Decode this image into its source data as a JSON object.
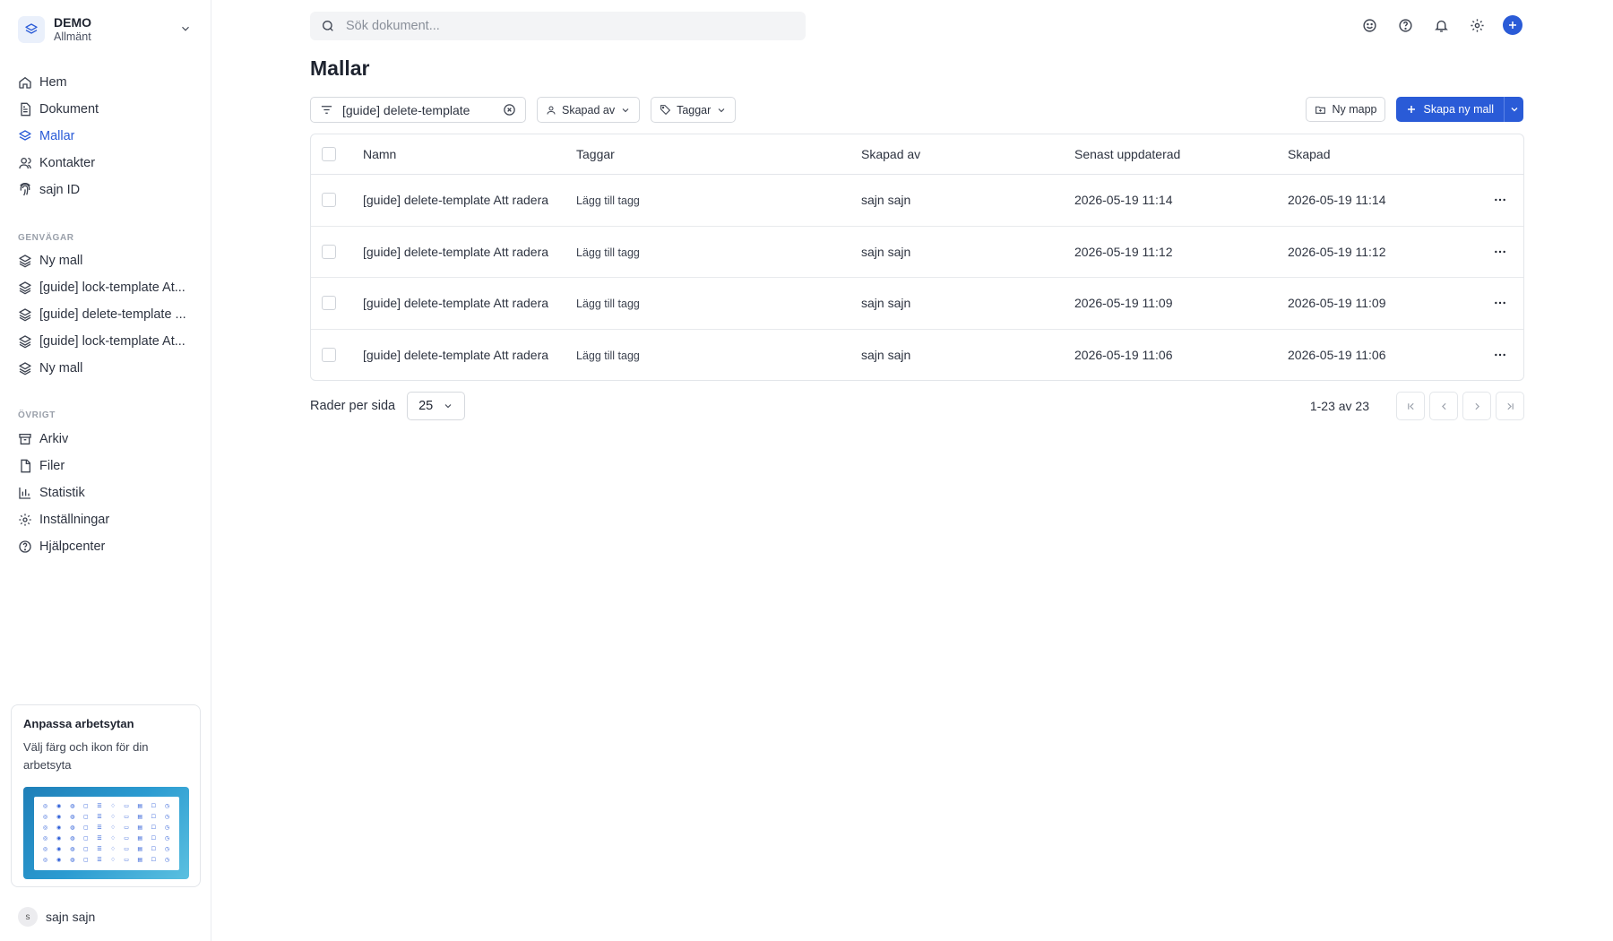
{
  "workspace": {
    "name": "DEMO",
    "subtitle": "Allmänt"
  },
  "nav": [
    {
      "label": "Hem",
      "icon": "home-icon",
      "active": false
    },
    {
      "label": "Dokument",
      "icon": "document-icon",
      "active": false
    },
    {
      "label": "Mallar",
      "icon": "layers-icon",
      "active": true
    },
    {
      "label": "Kontakter",
      "icon": "users-icon",
      "active": false
    },
    {
      "label": "sajn ID",
      "icon": "fingerprint-icon",
      "active": false
    }
  ],
  "shortcuts": {
    "heading": "GENVÄGAR",
    "items": [
      {
        "label": "Ny mall"
      },
      {
        "label": "[guide] lock-template At..."
      },
      {
        "label": "[guide] delete-template ..."
      },
      {
        "label": "[guide] lock-template At..."
      },
      {
        "label": "Ny mall"
      }
    ]
  },
  "other": {
    "heading": "ÖVRIGT",
    "items": [
      {
        "label": "Arkiv",
        "icon": "archive-icon"
      },
      {
        "label": "Filer",
        "icon": "file-icon"
      },
      {
        "label": "Statistik",
        "icon": "bar-chart-icon"
      },
      {
        "label": "Inställningar",
        "icon": "gear-icon"
      },
      {
        "label": "Hjälpcenter",
        "icon": "help-circle-icon"
      }
    ]
  },
  "promo": {
    "title": "Anpassa arbetsytan",
    "description": "Välj färg och ikon för din arbetsyta"
  },
  "user": {
    "initial": "s",
    "name": "sajn sajn"
  },
  "search": {
    "placeholder": "Sök dokument..."
  },
  "page": {
    "title": "Mallar"
  },
  "filters": {
    "query": "[guide] delete-template",
    "created_by_label": "Skapad av",
    "tags_label": "Taggar"
  },
  "actions": {
    "new_folder": "Ny mapp",
    "create_template": "Skapa ny mall"
  },
  "table": {
    "headers": {
      "name": "Namn",
      "tags": "Taggar",
      "created_by": "Skapad av",
      "updated": "Senast uppdaterad",
      "created": "Skapad"
    },
    "rows": [
      {
        "name": "[guide] delete-template Att radera",
        "tags": "Lägg till tagg",
        "created_by": "sajn sajn",
        "updated": "2026-05-19 11:14",
        "created": "2026-05-19 11:14"
      },
      {
        "name": "[guide] delete-template Att radera",
        "tags": "Lägg till tagg",
        "created_by": "sajn sajn",
        "updated": "2026-05-19 11:12",
        "created": "2026-05-19 11:12"
      },
      {
        "name": "[guide] delete-template Att radera",
        "tags": "Lägg till tagg",
        "created_by": "sajn sajn",
        "updated": "2026-05-19 11:09",
        "created": "2026-05-19 11:09"
      },
      {
        "name": "[guide] delete-template Att radera",
        "tags": "Lägg till tagg",
        "created_by": "sajn sajn",
        "updated": "2026-05-19 11:06",
        "created": "2026-05-19 11:06"
      }
    ]
  },
  "pagination": {
    "rows_per_page_label": "Rader per sida",
    "rows_per_page": "25",
    "count": "1-23 av 23"
  },
  "colors": {
    "accent": "#2a5bd7",
    "border": "#e3e6ea",
    "text": "#1f2430"
  }
}
